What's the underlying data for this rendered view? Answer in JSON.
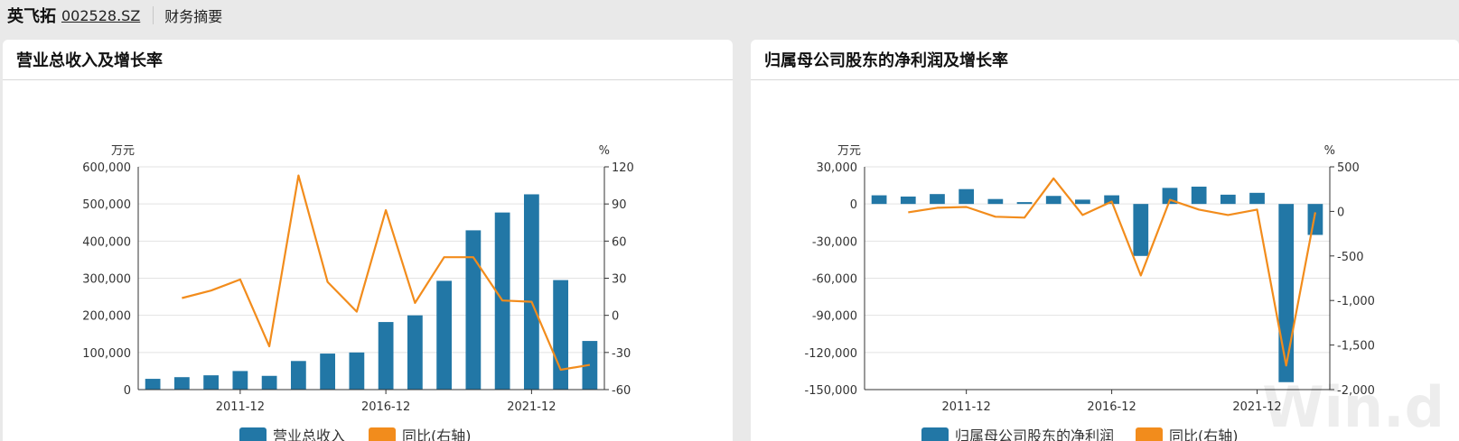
{
  "header": {
    "stock_name": "英飞拓",
    "stock_code": "002528.SZ",
    "page_title": "财务摘要"
  },
  "colors": {
    "bar": "#2277a6",
    "line": "#f28c1c",
    "grid": "#e3e3e3",
    "axis": "#333333"
  },
  "watermark": "Win.d",
  "chart_data": [
    {
      "type": "bar",
      "title": "营业总收入及增长率",
      "y_unit_label": "万元",
      "y2_unit_label": "%",
      "ylim": [
        0,
        600000
      ],
      "yticks": [
        0,
        100000,
        200000,
        300000,
        400000,
        500000,
        600000
      ],
      "ytick_labels": [
        "0",
        "100,000",
        "200,000",
        "300,000",
        "400,000",
        "500,000",
        "600,000"
      ],
      "y2lim": [
        -60,
        120
      ],
      "y2ticks": [
        -60,
        -30,
        0,
        30,
        60,
        90,
        120
      ],
      "y2tick_labels": [
        "-60",
        "-30",
        "0",
        "30",
        "60",
        "90",
        "120"
      ],
      "x": [
        "2008-12",
        "2009-12",
        "2010-12",
        "2011-12",
        "2012-12",
        "2013-12",
        "2014-12",
        "2015-12",
        "2016-12",
        "2017-12",
        "2018-12",
        "2019-12",
        "2020-12",
        "2021-12",
        "2022-12"
      ],
      "xtick_labels": {
        "3": "2011-12",
        "8": "2016-12",
        "13": "2021-12"
      },
      "grid": true,
      "legend_position": "bottom",
      "series": [
        {
          "name": "营业总收入",
          "type": "bar",
          "axis": "left",
          "values": [
            29000,
            33500,
            38500,
            50000,
            37000,
            77000,
            97000,
            100000,
            182000,
            200000,
            293000,
            429000,
            477000,
            526000,
            295000,
            131000
          ]
        },
        {
          "name": "同比(右轴)",
          "type": "line",
          "axis": "right",
          "values": [
            null,
            14,
            20,
            29,
            -25,
            113,
            27,
            3,
            85,
            10,
            47,
            47,
            12,
            11,
            -44,
            -40
          ]
        }
      ]
    },
    {
      "type": "bar",
      "title": "归属母公司股东的净利润及增长率",
      "y_unit_label": "万元",
      "y2_unit_label": "%",
      "ylim": [
        -150000,
        30000
      ],
      "yticks": [
        -150000,
        -120000,
        -90000,
        -60000,
        -30000,
        0,
        30000
      ],
      "ytick_labels": [
        "-150,000",
        "-120,000",
        "-90,000",
        "-60,000",
        "-30,000",
        "0",
        "30,000"
      ],
      "y2lim": [
        -2000,
        500
      ],
      "y2ticks": [
        -2000,
        -1500,
        -1000,
        -500,
        0,
        500
      ],
      "y2tick_labels": [
        "-2,000",
        "-1,500",
        "-1,000",
        "-500",
        "0",
        "500"
      ],
      "x": [
        "2008-12",
        "2009-12",
        "2010-12",
        "2011-12",
        "2012-12",
        "2013-12",
        "2014-12",
        "2015-12",
        "2016-12",
        "2017-12",
        "2018-12",
        "2019-12",
        "2020-12",
        "2021-12",
        "2022-12"
      ],
      "xtick_labels": {
        "3": "2011-12",
        "8": "2016-12",
        "13": "2021-12"
      },
      "grid": true,
      "legend_position": "bottom",
      "series": [
        {
          "name": "归属母公司股东的净利润",
          "type": "bar",
          "axis": "left",
          "values": [
            7000,
            6000,
            8000,
            12000,
            4000,
            1500,
            6500,
            3500,
            7000,
            -42000,
            13000,
            14000,
            7500,
            9000,
            -144000,
            -25000
          ]
        },
        {
          "name": "同比(右轴)",
          "type": "line",
          "axis": "right",
          "values": [
            null,
            -10,
            40,
            50,
            -60,
            -70,
            370,
            -40,
            110,
            -720,
            130,
            20,
            -40,
            20,
            -1730,
            -10
          ]
        }
      ]
    }
  ]
}
